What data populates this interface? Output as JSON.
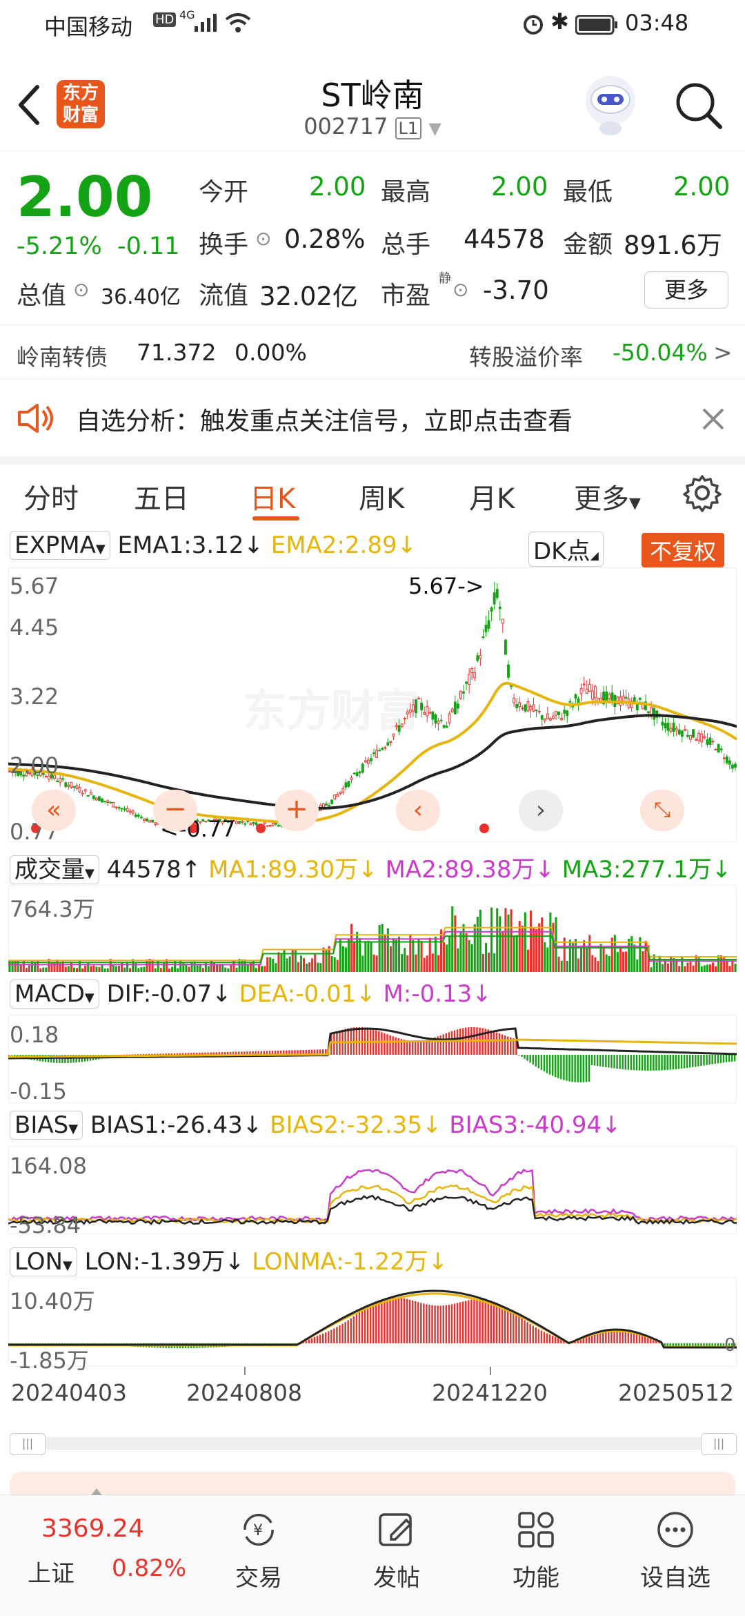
{
  "status": {
    "carrier": "中国移动",
    "time": "03:48",
    "net": "4G"
  },
  "header": {
    "logo_line1": "东方",
    "logo_line2": "财富",
    "title": "ST岭南",
    "code": "002717",
    "level": "L1"
  },
  "quote": {
    "price": "2.00",
    "change_pct": "-5.21%",
    "change_amt": "-0.11",
    "open_label": "今开",
    "open": "2.00",
    "high_label": "最高",
    "high": "2.00",
    "low_label": "最低",
    "low": "2.00",
    "turnover_label": "换手",
    "turnover": "0.28%",
    "volume_label": "总手",
    "volume": "44578",
    "amount_label": "金额",
    "amount": "891.6万",
    "mktcap_label": "总值",
    "mktcap": "36.40亿",
    "float_label": "流值",
    "float": "32.02亿",
    "pe_label": "市盈",
    "pe_sup": "静",
    "pe": "-3.70",
    "more_label": "更多"
  },
  "bond": {
    "name": "岭南转债",
    "price": "71.372",
    "pct": "0.00%",
    "premium_label": "转股溢价率",
    "premium": "-50.04%",
    "arrow": ">"
  },
  "banner": {
    "text": "自选分析：触发重点关注信号，立即点击查看"
  },
  "tabs": [
    "分时",
    "五日",
    "日K",
    "周K",
    "月K",
    "更多"
  ],
  "kline": {
    "indicator": "EXPMA",
    "ema1": "EMA1:3.12",
    "ema1_arrow": "↓",
    "ema2": "EMA2:2.89",
    "ema2_arrow": "↓",
    "dk": "DK点",
    "fq": "不复权",
    "y_max": "5.67",
    "y_2": "4.45",
    "y_3": "3.22",
    "y_4": "2.00",
    "y_min": "0.77",
    "hi_note": "5.67->",
    "lo_note": "<-0.77",
    "watermark": "东方财富"
  },
  "volume": {
    "indicator": "成交量",
    "vol": "44578",
    "vol_arrow": "↑",
    "ma1": "MA1:89.30万",
    "ma1_arrow": "↓",
    "ma2": "MA2:89.38万",
    "ma2_arrow": "↓",
    "ma3": "MA3:277.1万",
    "ma3_arrow": "↓",
    "y_max": "764.3万"
  },
  "macd": {
    "indicator": "MACD",
    "dif": "DIF:-0.07",
    "dif_arrow": "↓",
    "dea": "DEA:-0.01",
    "dea_arrow": "↓",
    "m": "M:-0.13",
    "m_arrow": "↓",
    "y_max": "0.18",
    "y_min": "-0.15"
  },
  "bias": {
    "indicator": "BIAS",
    "b1": "BIAS1:-26.43",
    "b1_arrow": "↓",
    "b2": "BIAS2:-32.35",
    "b2_arrow": "↓",
    "b3": "BIAS3:-40.94",
    "b3_arrow": "↓",
    "y_max": "164.08",
    "y_min": "-53.84"
  },
  "lon": {
    "indicator": "LON",
    "lon": "LON:-1.39万",
    "lon_arrow": "↓",
    "lonma": "LONMA:-1.22万",
    "lonma_arrow": "↓",
    "y_max": "10.40万",
    "y_min": "-1.85万",
    "zero": "0"
  },
  "dates": [
    "20240403",
    "20240808",
    "20241220",
    "20250512"
  ],
  "bottom": {
    "index_value": "3369.24",
    "index_name": "上证",
    "index_pct": "0.82%",
    "items": [
      "交易",
      "发帖",
      "功能",
      "设自选"
    ]
  },
  "colors": {
    "up": "#e8322b",
    "down": "#14a314",
    "ema2": "#e7b40a",
    "ema1": "#222222",
    "accent": "#e8561c"
  }
}
